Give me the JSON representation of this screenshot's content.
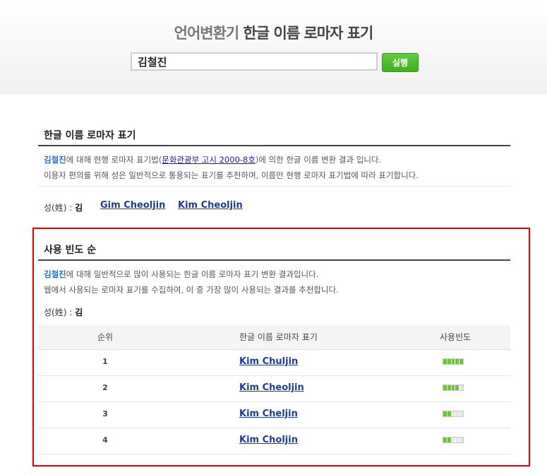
{
  "header": {
    "brand": "언어변환기",
    "title": "한글 이름 로마자 표기",
    "search_value": "김철진",
    "run_label": "실행"
  },
  "section1": {
    "title": "한글 이름 로마자 표기",
    "name": "김철진",
    "line1_a": "에 대해 현행 로마자 표기법(",
    "law_link": "문화관광부 고시 2000-8호",
    "line1_b": ")에 의한 한글 이름 변환 결과 입니다.",
    "line2": "이용자 편의를 위해 성은 일반적으로 통용되는 표기를 추천하며, 이름만 현행 로마자 표기법에 따라 표기합니다.",
    "surname_label": "성(姓) : ",
    "surname": "김",
    "romanizations": [
      "Gim Cheoljin",
      "Kim Cheoljin"
    ]
  },
  "section2": {
    "title": "사용 빈도 순",
    "name": "김철진",
    "line1": "에 대해 일반적으로 많이 사용되는 한글 이름 로마자 표기 변환 결과입니다.",
    "line2": "웹에서 사용되는 로마자 표기를 수집하여, 이 중 가장 많이 사용되는 결과를 추천합니다.",
    "surname_label": "성(姓) : ",
    "surname": "김",
    "columns": [
      "순위",
      "한글 이름 로마자 표기",
      "사용빈도"
    ],
    "rows": [
      {
        "rank": "1",
        "name": "Kim Chuljin",
        "freq_level": 5
      },
      {
        "rank": "2",
        "name": "Kim Cheoljin",
        "freq_level": 4
      },
      {
        "rank": "3",
        "name": "Kim Cheljin",
        "freq_level": 2
      },
      {
        "rank": "4",
        "name": "Kim Choljin",
        "freq_level": 2
      }
    ],
    "freq_max": 5
  },
  "colors": {
    "accent_green": "#3fae1f",
    "highlight_red": "#e00000",
    "name_blue": "#2a6fd6",
    "link_blue": "#1e3d8f"
  }
}
